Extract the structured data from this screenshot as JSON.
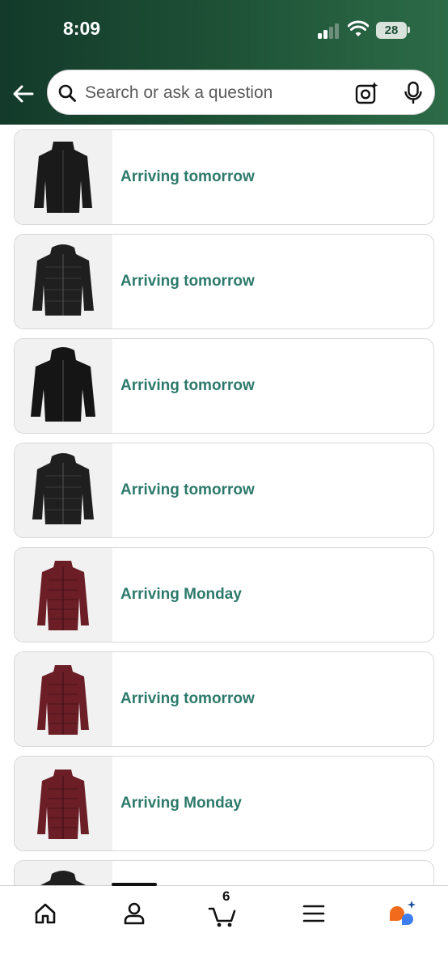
{
  "status_bar": {
    "time": "8:09",
    "battery": "28"
  },
  "search": {
    "placeholder": "Search or ask a question"
  },
  "orders": [
    {
      "status": "Arriving tomorrow",
      "jacket_color": "#1a1a1a"
    },
    {
      "status": "Arriving tomorrow",
      "jacket_color": "#1f1f1f"
    },
    {
      "status": "Arriving tomorrow",
      "jacket_color": "#151515"
    },
    {
      "status": "Arriving tomorrow",
      "jacket_color": "#1f1f1f"
    },
    {
      "status": "Arriving Monday",
      "jacket_color": "#6b1e26"
    },
    {
      "status": "Arriving tomorrow",
      "jacket_color": "#6b1e26"
    },
    {
      "status": "Arriving Monday",
      "jacket_color": "#6b1e26"
    }
  ],
  "bottom_nav": {
    "cart_count": "6"
  },
  "colors": {
    "header": "#1d4f35",
    "status_text": "#2d7a6b",
    "card_border": "#d5d9d9"
  }
}
